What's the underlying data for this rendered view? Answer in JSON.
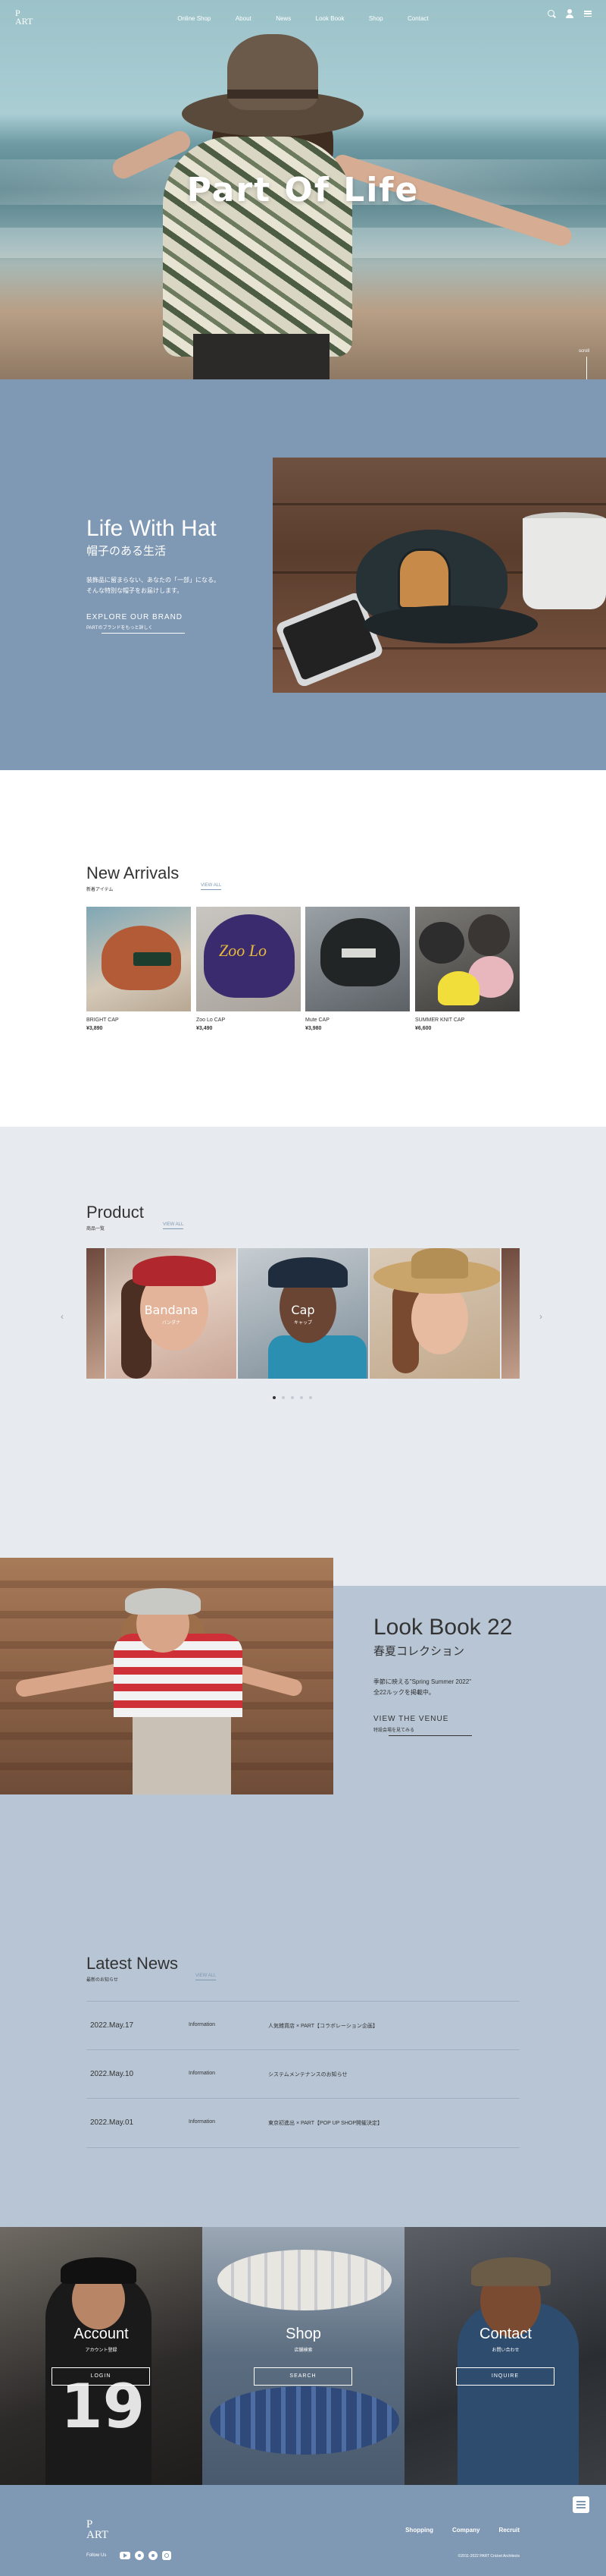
{
  "header": {
    "logo_line1": "P",
    "logo_line2": "ART",
    "nav": [
      "Online Shop",
      "About",
      "News",
      "Look Book",
      "Shop",
      "Contact"
    ]
  },
  "hero": {
    "title": "Part Of Life",
    "scroll": "scroll"
  },
  "life": {
    "title": "Life With Hat",
    "subtitle": "帽子のある生活",
    "desc1": "装飾品に留まらない、あなたの「一部」になる。",
    "desc2": "そんな特別な帽子をお届けします。",
    "link": "EXPLORE OUR BRAND",
    "link_sub": "PARTのブランドをもっと詳しく"
  },
  "new_arrivals": {
    "title": "New Arrivals",
    "subtitle": "新着アイテム",
    "view_all": "VIEW ALL",
    "items": [
      {
        "name": "BRIGHT CAP",
        "price": "¥3,890"
      },
      {
        "name": "Zoo Lo CAP",
        "price": "¥3,490"
      },
      {
        "name": "Mute CAP",
        "price": "¥3,980"
      },
      {
        "name": "SUMMER KNIT CAP",
        "price": "¥6,600"
      }
    ],
    "cap2_text": "Zoo Lo"
  },
  "product": {
    "title": "Product",
    "subtitle": "商品一覧",
    "view_all": "VIEW ALL",
    "slides": [
      {
        "label": "Bandana",
        "sub": "バンダナ"
      },
      {
        "label": "Cap",
        "sub": "キャップ"
      },
      {
        "label": "",
        "sub": ""
      }
    ],
    "prev": "‹",
    "next": "›"
  },
  "lookbook": {
    "title": "Look Book 22",
    "subtitle": "春夏コレクション",
    "desc1": "季節に映える\"Spring Summer 2022\"",
    "desc2": "全22ルックを掲載中。",
    "link": "VIEW THE VENUE",
    "link_sub": "特設会場を見てみる"
  },
  "news": {
    "title": "Latest News",
    "subtitle": "最新のお知らせ",
    "view_all": "VIEW ALL",
    "items": [
      {
        "date": "2022.May.17",
        "category": "Information",
        "text": "人気雑貨店 × PART【コラボレーション企画】"
      },
      {
        "date": "2022.May.10",
        "category": "Information",
        "text": "システムメンテナンスのお知らせ"
      },
      {
        "date": "2022.May.01",
        "category": "Information",
        "text": "東京初進出 × PART【POP UP SHOP開催決定】"
      }
    ]
  },
  "cta": {
    "account": {
      "title": "Account",
      "sub": "アカウント登録",
      "button": "LOGIN"
    },
    "shop": {
      "title": "Shop",
      "sub": "店舗検索",
      "button": "SEARCH"
    },
    "contact": {
      "title": "Contact",
      "sub": "お問い合わせ",
      "button": "INQUIRE"
    },
    "account_number": "19"
  },
  "footer": {
    "logo_line1": "P",
    "logo_line2": "ART",
    "links": [
      "Shopping",
      "Company",
      "Recruit"
    ],
    "follow": "Follow Us",
    "copyright": "©2011-2022 PART Cricket Architects"
  }
}
